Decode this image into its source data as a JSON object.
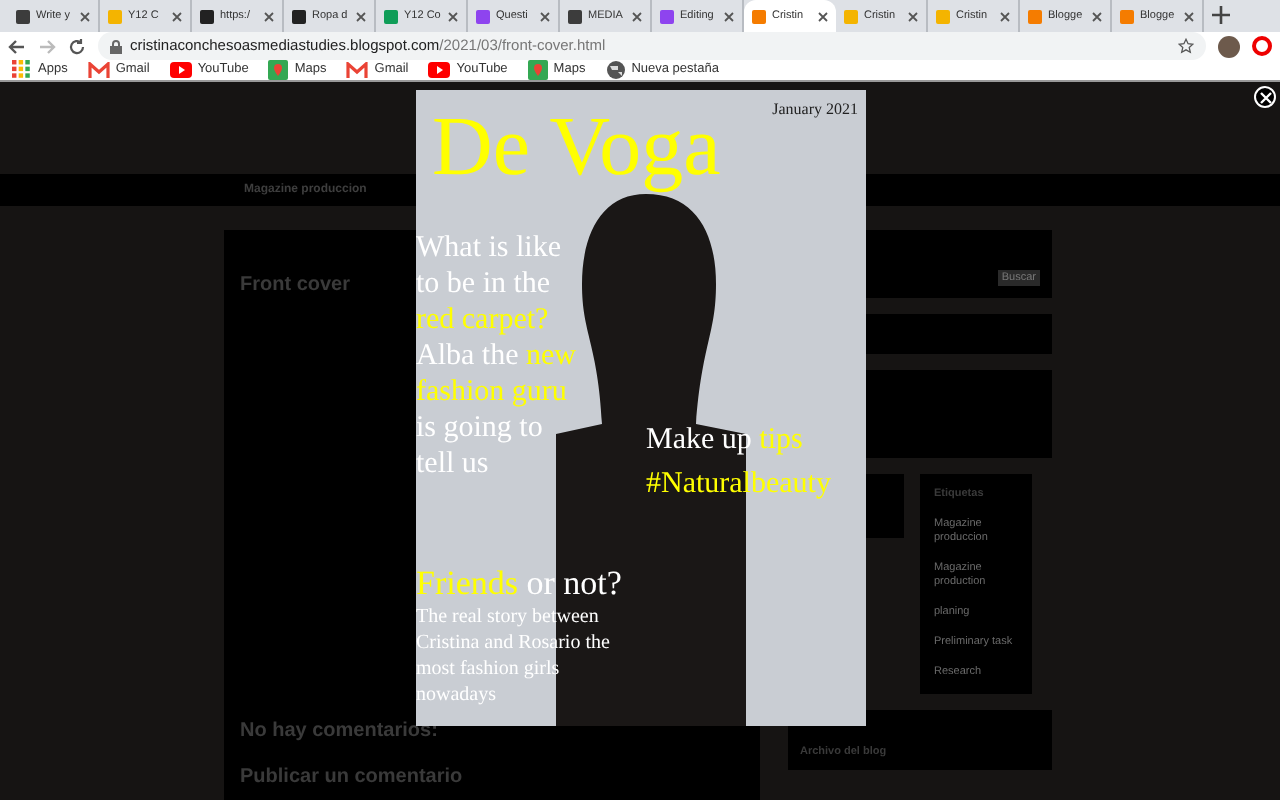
{
  "tabs": [
    {
      "label": "Write y",
      "color": "#3c3c3c",
      "selected": false
    },
    {
      "label": "Y12 C",
      "color": "#f4b400",
      "selected": false
    },
    {
      "label": "https:/",
      "color": "#222222",
      "selected": false
    },
    {
      "label": "Ropa d",
      "color": "#222222",
      "selected": false
    },
    {
      "label": "Y12 Co",
      "color": "#0f9d58",
      "selected": false
    },
    {
      "label": "Questi",
      "color": "#8e44ef",
      "selected": false
    },
    {
      "label": "MEDIA",
      "color": "#3c3c3c",
      "selected": false
    },
    {
      "label": "Editing",
      "color": "#8e44ef",
      "selected": false
    },
    {
      "label": "Cristin",
      "color": "#f57c00",
      "selected": true
    },
    {
      "label": "Cristin",
      "color": "#f4b400",
      "selected": false
    },
    {
      "label": "Cristin",
      "color": "#f4b400",
      "selected": false
    },
    {
      "label": "Blogge",
      "color": "#f57c00",
      "selected": false
    },
    {
      "label": "Blogge",
      "color": "#f57c00",
      "selected": false
    }
  ],
  "address": {
    "host": "cristinaconchesoasmediastudies.blogspot.com",
    "path": "/2021/03/front-cover.html"
  },
  "bookmarks": [
    {
      "label": "Apps",
      "kind": "apps"
    },
    {
      "label": "Gmail",
      "kind": "gmail"
    },
    {
      "label": "YouTube",
      "kind": "youtube"
    },
    {
      "label": "Maps",
      "kind": "maps"
    },
    {
      "label": "Gmail",
      "kind": "gmail"
    },
    {
      "label": "YouTube",
      "kind": "youtube"
    },
    {
      "label": "Maps",
      "kind": "maps"
    },
    {
      "label": "Nueva pestaña",
      "kind": "globe"
    }
  ],
  "blog": {
    "nav": "Magazine produccion",
    "post_title": "Front cover",
    "comments": "No hay comentarios:",
    "post_comment": "Publicar un comentario",
    "search_button": "Buscar",
    "labels_title": "Etiquetas",
    "labels": [
      "Magazine produccion",
      "Magazine production",
      "planing",
      "Preliminary task",
      "Research"
    ],
    "archive_title": "Archivo del blog"
  },
  "cover": {
    "date": "January 2021",
    "masthead": "De Voga",
    "story1": [
      {
        "text": "What is like",
        "highlight": false
      },
      {
        "text": "to be in the",
        "highlight": false
      },
      {
        "text": "red carpet?",
        "highlight": true
      },
      {
        "text": "Alba  the **new**",
        "highlight": false
      },
      {
        "text": "fashion guru",
        "highlight": true
      },
      {
        "text": "is going to",
        "highlight": false
      },
      {
        "text": "tell us",
        "highlight": false
      }
    ],
    "story2": [
      {
        "text": "Make up **tips**",
        "highlight": false
      },
      {
        "text": "#Naturalbeauty",
        "highlight": true
      }
    ],
    "story3_head": "**Friends**  or not?",
    "story3": "The real story between Cristina and Rosario the most  fashion girls nowadays"
  }
}
